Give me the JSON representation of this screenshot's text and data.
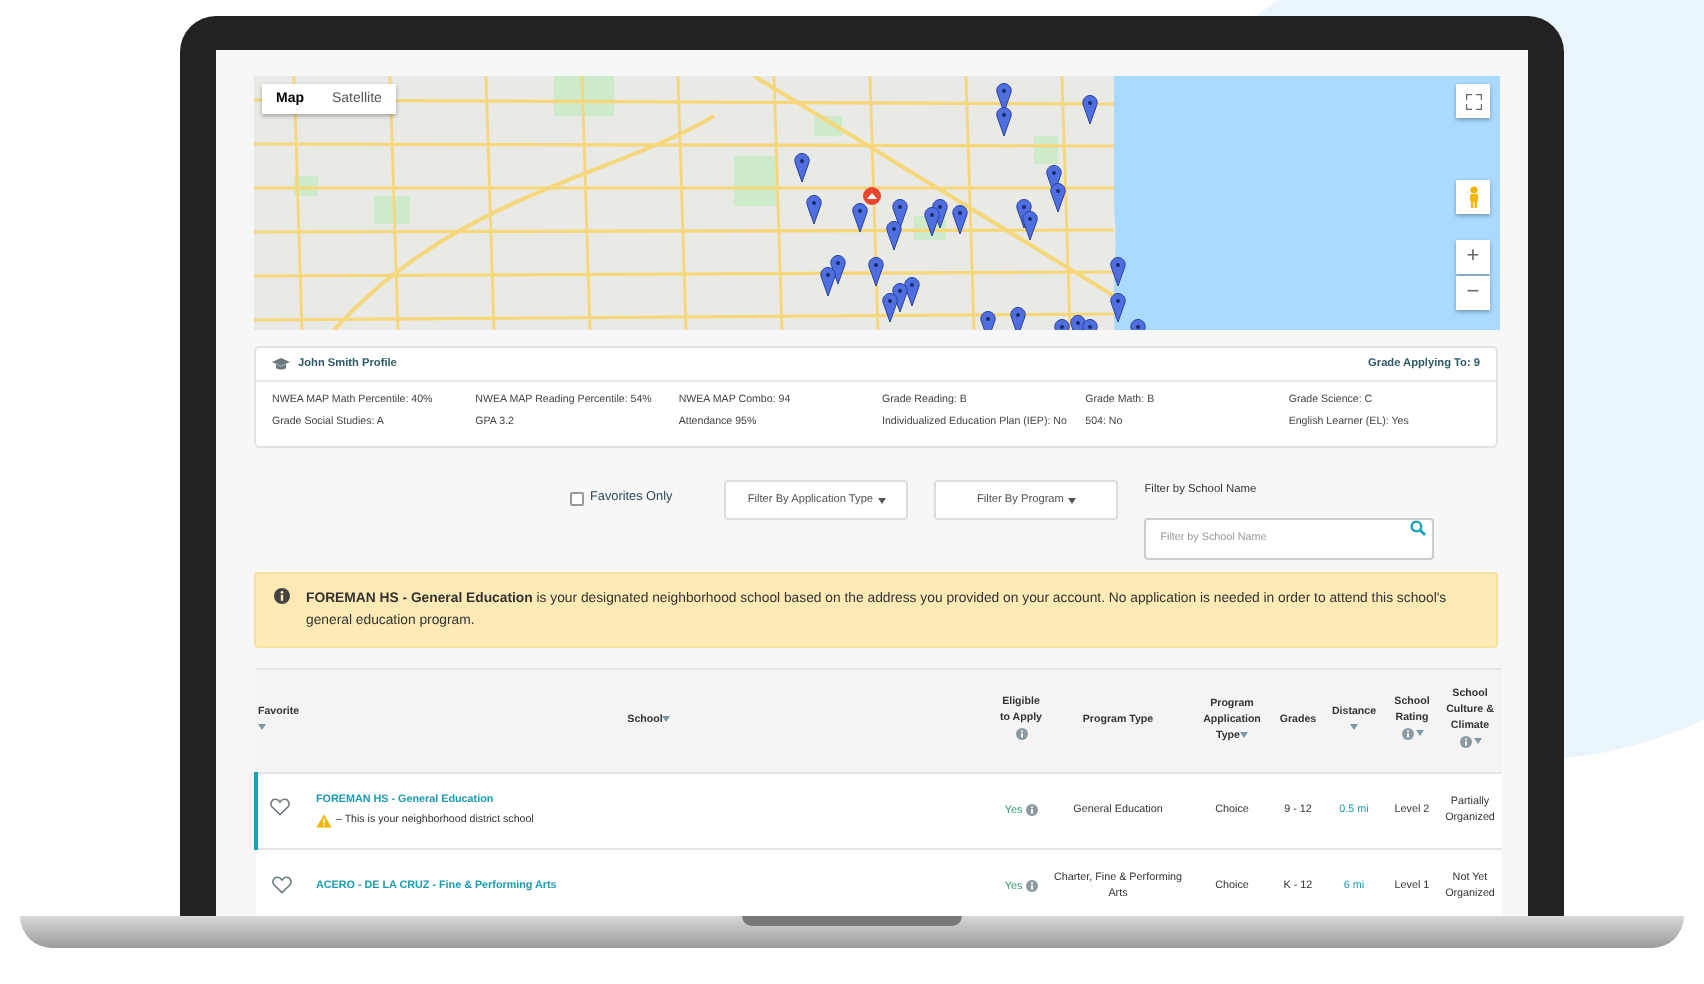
{
  "map": {
    "view_tabs": [
      {
        "label": "Map",
        "selected": true
      },
      {
        "label": "Satellite",
        "selected": false
      }
    ],
    "zoom_in": "+",
    "zoom_out": "−"
  },
  "profile": {
    "title": "John Smith Profile",
    "grade_applying": "Grade Applying To: 9",
    "fields": [
      "NWEA MAP Math Percentile: 40%",
      "NWEA MAP Reading Percentile: 54%",
      "NWEA MAP Combo: 94",
      "Grade Reading: B",
      "Grade Math: B",
      "Grade Science: C",
      "Grade Social Studies: A",
      "GPA 3.2",
      "Attendance 95%",
      "Individualized Education Plan (IEP): No",
      "504: No",
      "English Learner (EL): Yes"
    ]
  },
  "filters": {
    "favorites_only": {
      "label": "Favorites Only",
      "checked": false
    },
    "dropdowns": [
      "Filter By Application Type",
      "Filter By Program"
    ],
    "search": {
      "label": "Filter by School Name",
      "placeholder": "Filter by School Name"
    }
  },
  "notice": {
    "text": "**FOREMAN HS - General Education** is your designated neighborhood school based on the address you provided on your account. No application is needed in order to attend this school's general education program."
  },
  "table": {
    "columns": [
      {
        "label": "Favorite",
        "sortable": true,
        "info": false
      },
      {
        "label": "School",
        "sortable": true,
        "info": false
      },
      {
        "label": "Eligible to Apply",
        "sortable": false,
        "info": true
      },
      {
        "label": "Program Type",
        "sortable": false,
        "info": false
      },
      {
        "label": "Program Application Type",
        "sortable": true,
        "info": false
      },
      {
        "label": "Grades",
        "sortable": false,
        "info": false
      },
      {
        "label": "Distance",
        "sortable": true,
        "info": false
      },
      {
        "label": "School Rating",
        "sortable": true,
        "info": true
      },
      {
        "label": "School Culture & Climate",
        "sortable": true,
        "info": true
      }
    ],
    "rows": [
      {
        "favorite": false,
        "highlighted": true,
        "school": "FOREMAN HS - General Education",
        "note": "– This is your neighborhood district school",
        "eligible": "Yes",
        "program_type": "General Education",
        "application_type": "Choice",
        "grades": "9 - 12",
        "distance": "0.5 mi",
        "rating": "Level 2",
        "culture": "Partially Organized"
      },
      {
        "favorite": false,
        "highlighted": false,
        "school": "ACERO - DE LA CRUZ - Fine & Performing Arts",
        "eligible": "Yes",
        "program_type": "Charter, Fine & Performing Arts",
        "application_type": "Choice",
        "grades": "K - 12",
        "distance": "6 mi",
        "rating": "Level 1",
        "culture": "Not Yet Organized"
      }
    ]
  }
}
